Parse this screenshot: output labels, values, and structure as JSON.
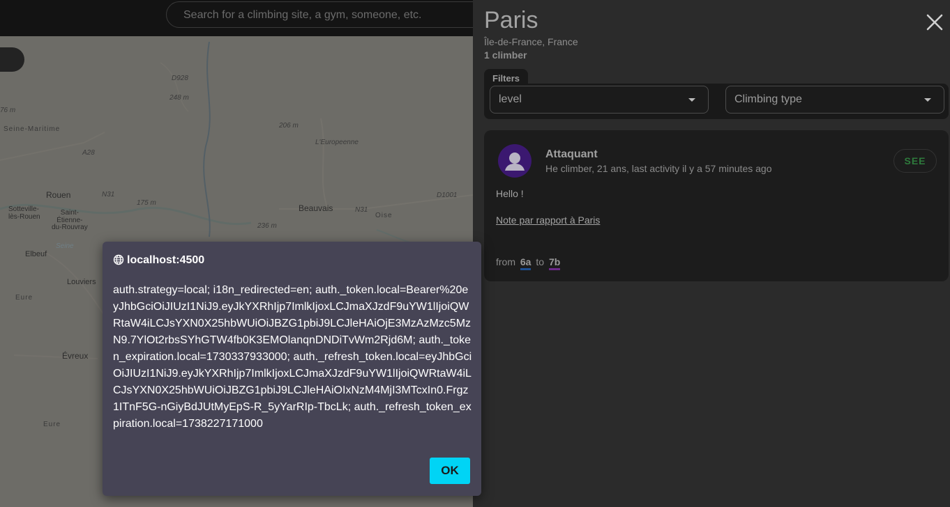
{
  "search": {
    "placeholder": "Search for a climbing site, a gym, someone, etc."
  },
  "map": {
    "labels": {
      "seine_maritime": "Seine-Maritime",
      "rouen": "Rouen",
      "sotteville": "Sotteville-\nlès-Rouen",
      "saint_etienne": "Saint-\nÉtienne-\ndu-Rouvray",
      "elbeuf": "Elbeuf",
      "louviers": "Louviers",
      "eure1": "Eure",
      "eure2": "Eure",
      "evreux": "Évreux",
      "beauvais": "Beauvais",
      "oise": "Oise",
      "n31a": "N31",
      "n31b": "N31",
      "a28": "A28",
      "d928": "D928",
      "d1001": "D1001",
      "leuropeenne": "L'Europeenne",
      "elev248": "248 m",
      "elev206": "206 m",
      "elev175": "175 m",
      "elev236": "236 m",
      "elev76": "76 m",
      "seine_river": "Seine"
    }
  },
  "panel": {
    "title": "Paris",
    "region": "Île-de-France, France",
    "count": "1 climber",
    "filters_label": "Filters",
    "level_select": "level",
    "type_select": "Climbing type"
  },
  "card": {
    "name": "Attaquant",
    "meta": "He climber, 21 ans, last activity il y a 57 minutes ago",
    "see_label": "SEE",
    "text": "Hello !",
    "link": "Note par rapport à Paris",
    "from_label": "from",
    "grade_from": "6a",
    "to_label": "to",
    "grade_to": "7b",
    "grade_from_color": "#1c4f93",
    "grade_to_color": "#6d2a8a"
  },
  "dialog": {
    "title": "localhost:4500",
    "body": "auth.strategy=local; i18n_redirected=en; auth._token.local=Bearer%20eyJhbGciOiJIUzI1NiJ9.eyJkYXRhIjp7ImlkIjoxLCJmaXJzdF9uYW1lIjoiQWRtaW4iLCJsYXN0X25hbWUiOiJBZG1pbiJ9LCJleHAiOjE3MzAzMzc5MzN9.7YlOt2rbsSYhGTW4fb0K3EMOlanqnDNDiTvWm2Rjd6M; auth._token_expiration.local=1730337933000; auth._refresh_token.local=eyJhbGciOiJIUzI1NiJ9.eyJkYXRhIjp7ImlkIjoxLCJmaXJzdF9uYW1lIjoiQWRtaW4iLCJsYXN0X25hbWUiOiJBZG1pbiJ9LCJleHAiOIxNzM4MjI3MTcxIn0.Frgz1ITnF5G-nGiyBdJUtMyEpS-R_5yYarRIp-TbcLk; auth._refresh_token_expiration.local=1738227171000",
    "ok_label": "OK"
  },
  "colors": {
    "accent": "#00d4f5",
    "panel_bg": "#2b2b2b",
    "dialog_bg": "#464455",
    "see_text": "#2e7a3c",
    "avatar_bg": "#3b1870"
  }
}
